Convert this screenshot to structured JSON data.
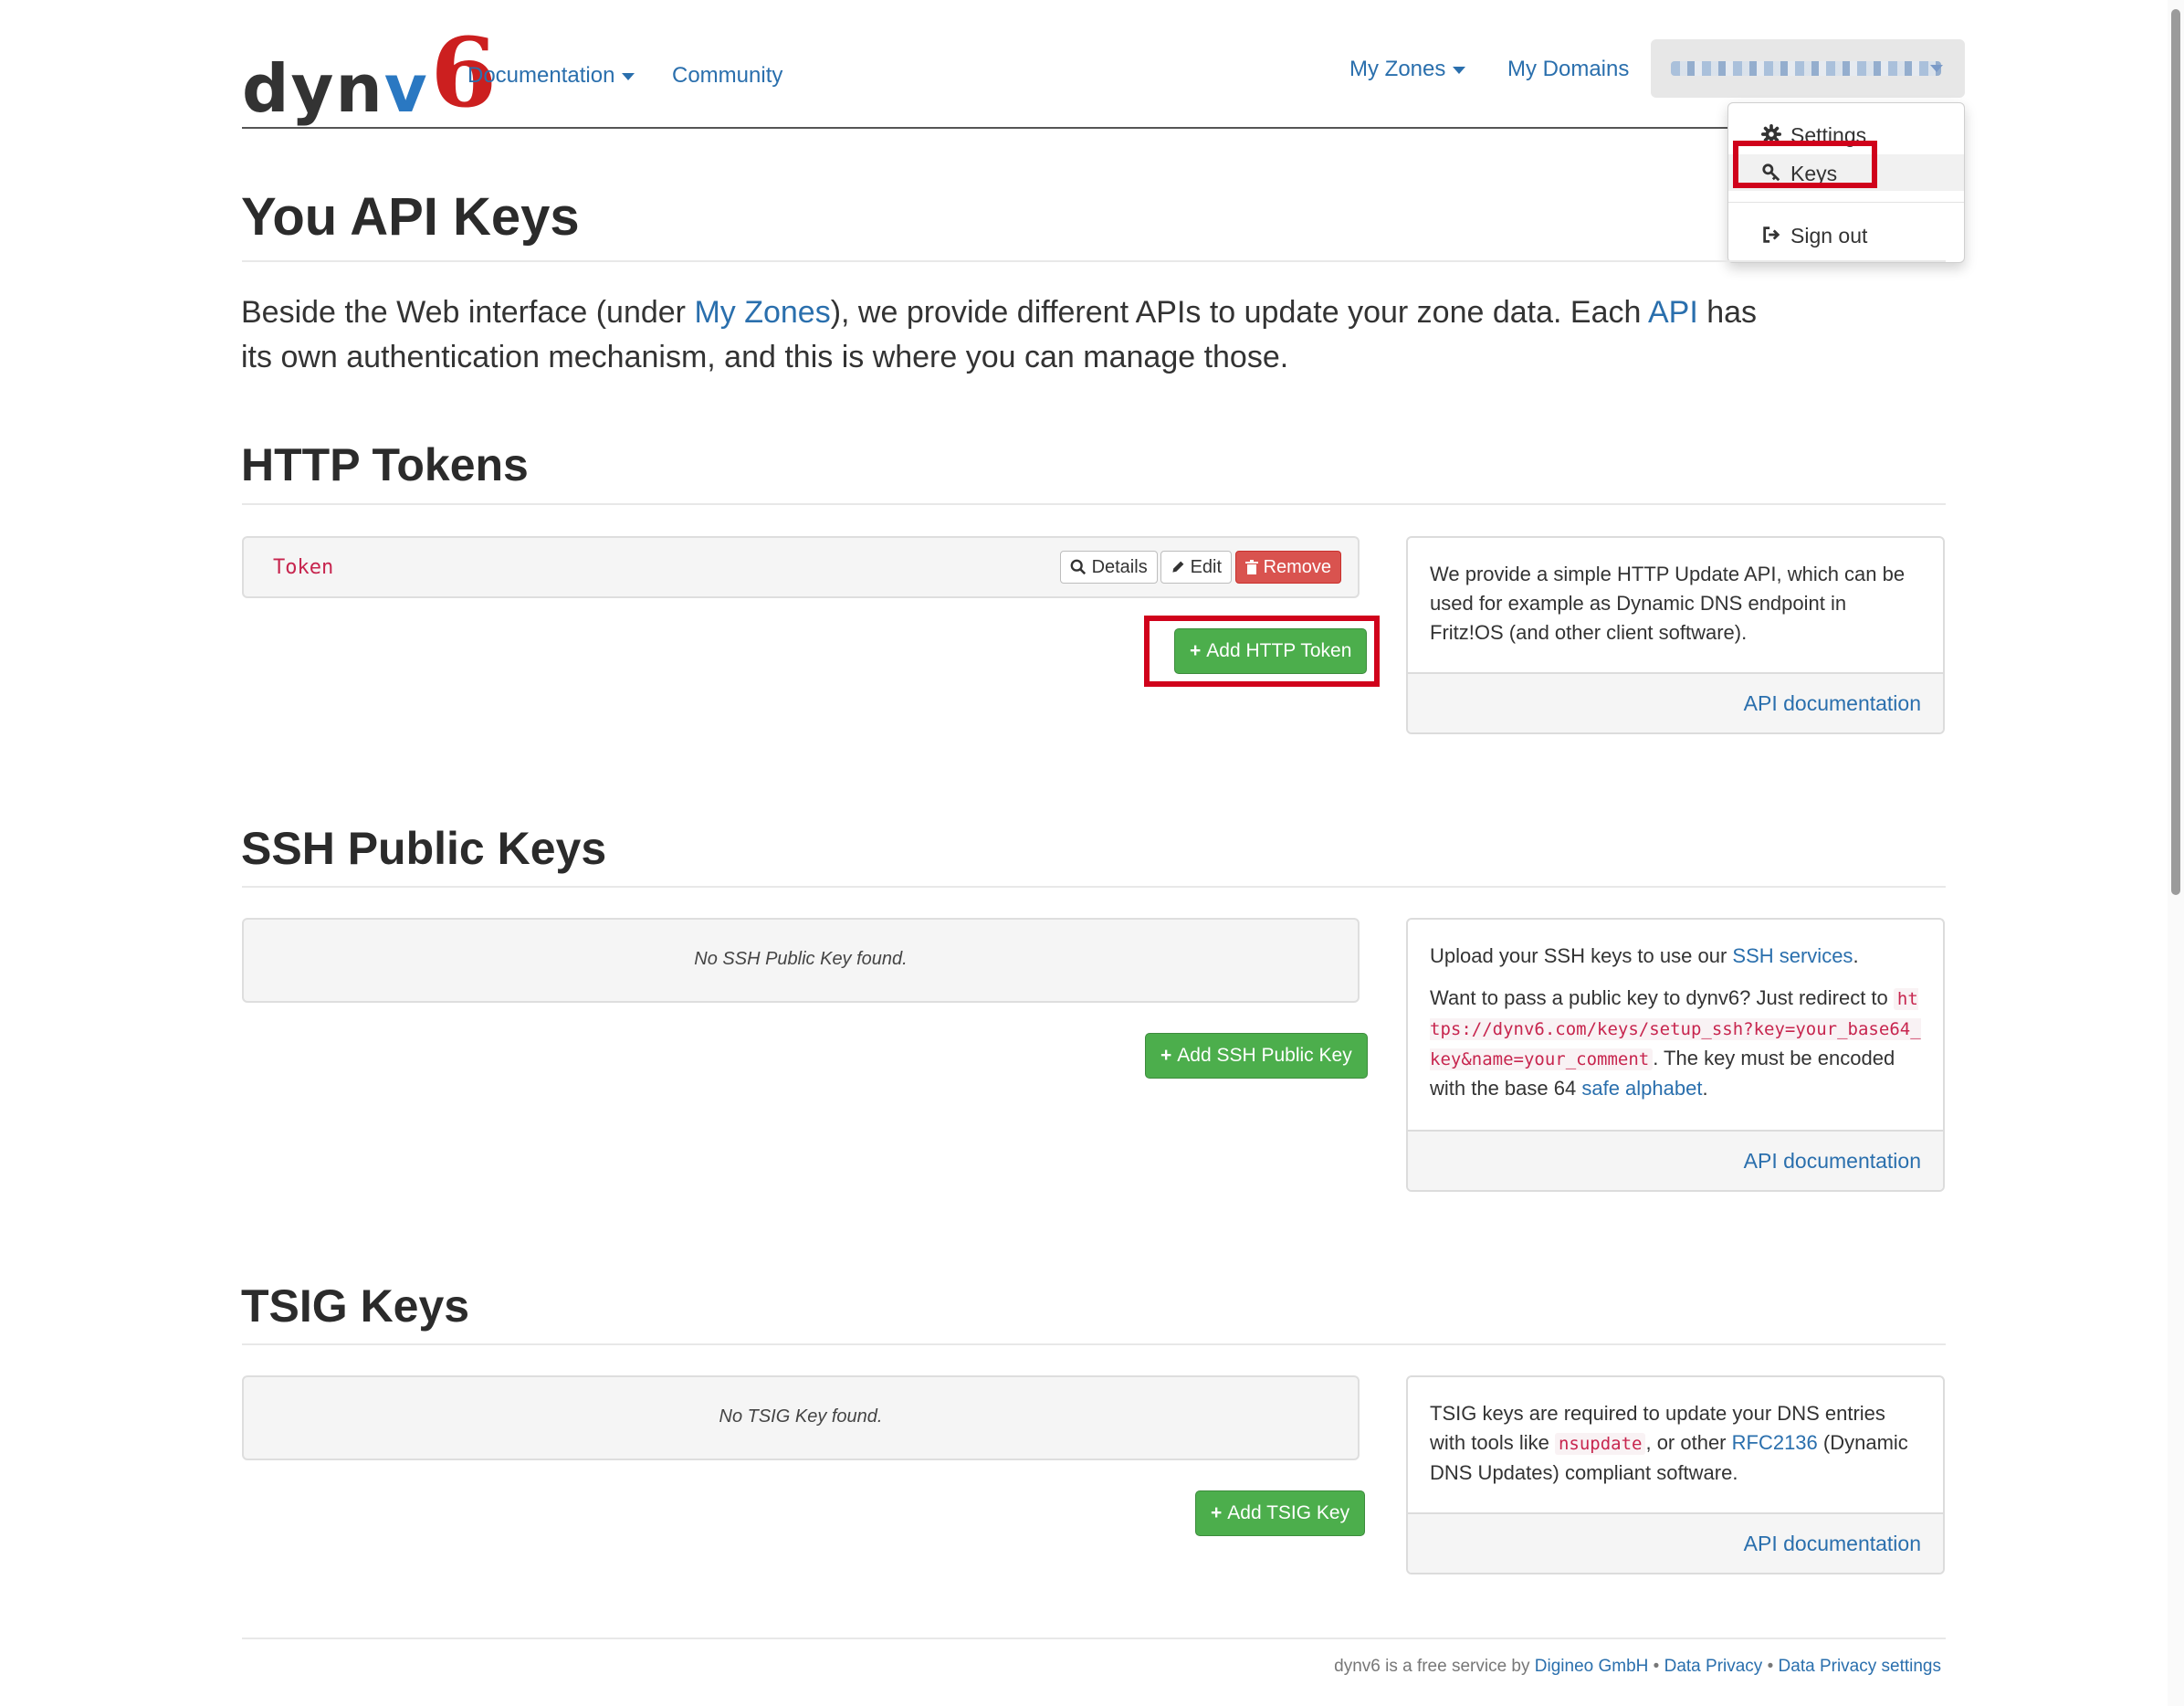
{
  "brand": {
    "part1": "dyn",
    "part2": "v",
    "part3": "6"
  },
  "nav": {
    "documentation": "Documentation",
    "community": "Community",
    "my_zones": "My Zones",
    "my_domains": "My Domains",
    "user_menu": {
      "dropdown": [
        {
          "label": "Settings",
          "icon": "gear-icon"
        },
        {
          "label": "Keys",
          "icon": "key-icon"
        },
        {
          "label": "Sign out",
          "icon": "sign-out-icon"
        }
      ]
    }
  },
  "page": {
    "title": "You API Keys",
    "lead": {
      "t1": "Beside the Web interface (under ",
      "link1": "My Zones",
      "t2": "), we provide different APIs to update your zone data. Each ",
      "link2": "API",
      "t3": " has its own authentication mechanism, and this is where you can manage those."
    }
  },
  "http_tokens": {
    "heading": "HTTP Tokens",
    "token_name": "Token",
    "details": "Details",
    "edit": "Edit",
    "remove": "Remove",
    "add": "Add HTTP Token",
    "info": "We provide a simple HTTP Update API, which can be used for example as Dynamic DNS endpoint in Fritz!OS (and other client software).",
    "doc_link": "API documentation"
  },
  "ssh_keys": {
    "heading": "SSH Public Keys",
    "empty": "No SSH Public Key found.",
    "add": "Add SSH Public Key",
    "info1_text": "Upload your SSH keys to use our ",
    "info1_link": "SSH services",
    "info1_end": ".",
    "info2_text": "Want to pass a public key to dynv6? Just redirect to ",
    "info2_code": "https://dynv6.com/keys/setup_ssh?key=your_base64_key&name=your_comment",
    "info2_mid": ". The key must be encoded with the base 64 ",
    "info2_link": "safe alphabet",
    "info2_end": ".",
    "doc_link": "API documentation"
  },
  "tsig_keys": {
    "heading": "TSIG Keys",
    "empty": "No TSIG Key found.",
    "add": "Add TSIG Key",
    "info_t1": "TSIG keys are required to update your DNS entries with tools like ",
    "info_code": "nsupdate",
    "info_t2": ", or other ",
    "info_link": "RFC2136",
    "info_t3": " (Dynamic DNS Updates) compliant software.",
    "doc_link": "API documentation"
  },
  "footer": {
    "text": "dynv6 is a free service by ",
    "company": "Digineo GmbH",
    "sep": " • ",
    "privacy": "Data Privacy",
    "privacy_settings": "Data Privacy settings"
  },
  "colors": {
    "link": "#2a6fad",
    "success": "#4cae4c",
    "danger": "#d9534f",
    "highlight": "#d0021b"
  }
}
